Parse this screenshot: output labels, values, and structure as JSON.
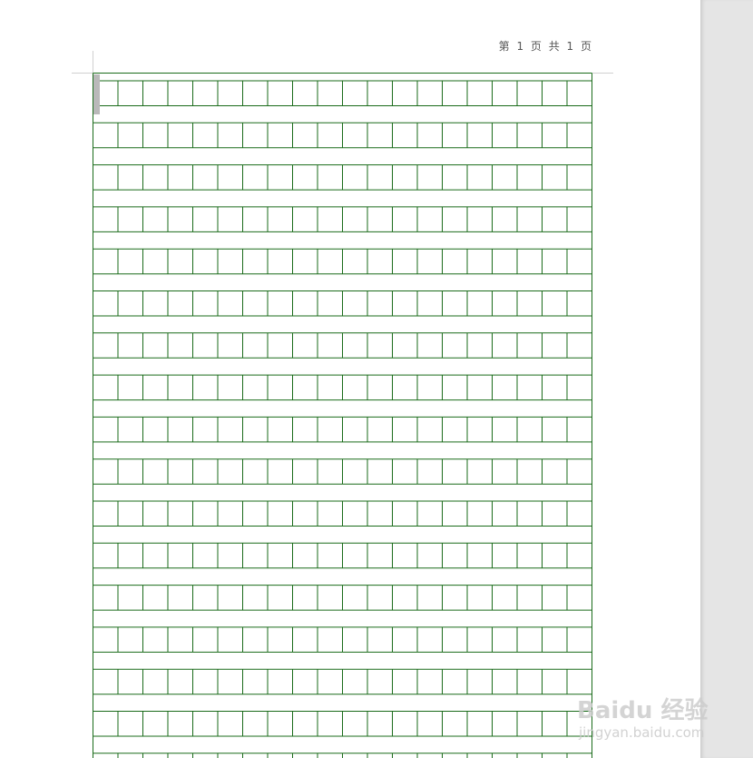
{
  "header": {
    "page_number_text": "第 1 页 共 1 页"
  },
  "manuscript_grid": {
    "line_color": "#1a6b1a",
    "columns_per_row": 20,
    "visible_rows": 17
  },
  "watermark": {
    "logo_text": "Baidu 经验",
    "url_text": "jingyan.baidu.com",
    "color": "#cdcdcd"
  },
  "colors": {
    "page_background": "#ffffff",
    "side_gutter": "#e5e5e5",
    "caret": "#b9b9b9"
  }
}
